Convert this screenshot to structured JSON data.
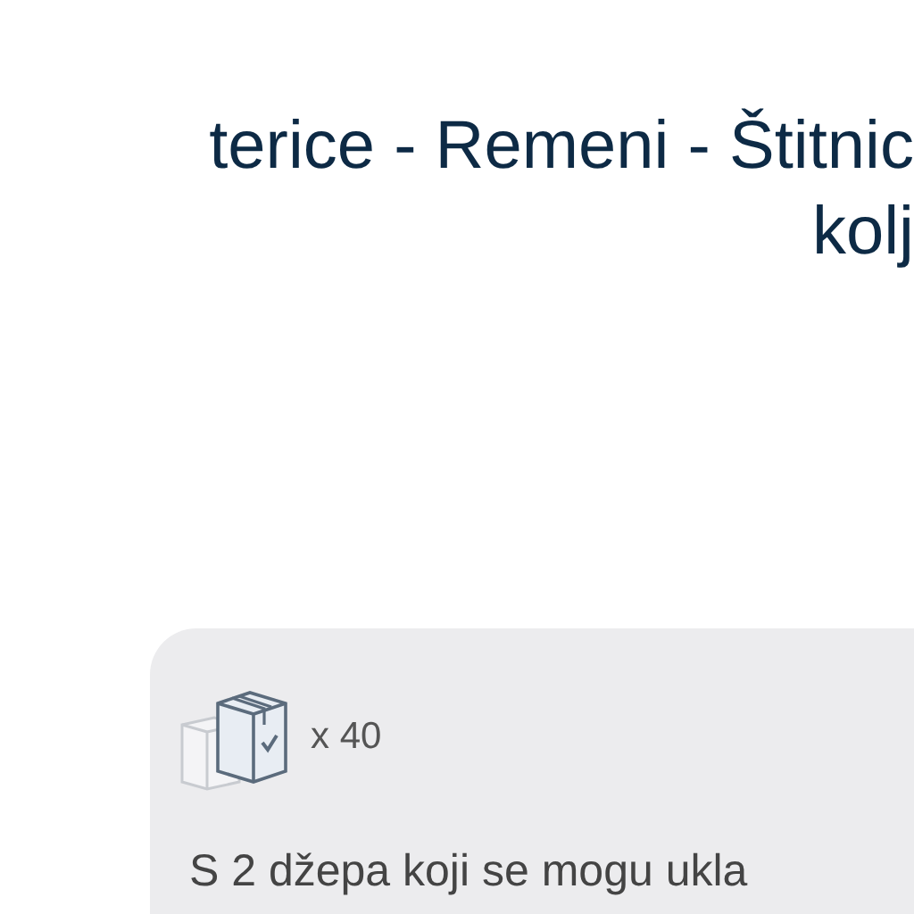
{
  "heading": {
    "lines": [
      "terice - Remeni - Štitnic",
      "kolj"
    ]
  },
  "card": {
    "quantity": "x 40",
    "description": "S 2 džepa koji se mogu ukla"
  }
}
